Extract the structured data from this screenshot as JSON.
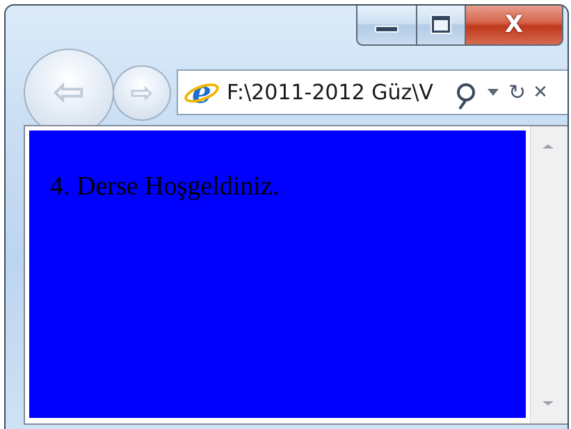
{
  "window": {
    "caption_buttons": {
      "minimize_icon": "minimize-icon",
      "maximize_icon": "maximize-icon",
      "close_icon": "close-icon",
      "close_glyph": "X"
    }
  },
  "navigation": {
    "back_icon": "back-arrow-icon",
    "back_glyph": "⇦",
    "forward_icon": "forward-arrow-icon",
    "forward_glyph": "⇨"
  },
  "address_bar": {
    "site_icon": "ie-page-icon",
    "site_icon_glyph": "e",
    "url": "F:\\2011-2012 Güz\\V",
    "search_icon": "search-icon",
    "dropdown_icon": "dropdown-icon",
    "refresh_icon": "refresh-icon",
    "refresh_glyph": "↻",
    "stop_icon": "stop-icon",
    "stop_glyph": "✕"
  },
  "content": {
    "background_color": "#0000ff",
    "text": "4. Derse Hoşgeldiniz."
  },
  "colors": {
    "close_button": "#c0391b",
    "frame": "#bcd5ef"
  }
}
